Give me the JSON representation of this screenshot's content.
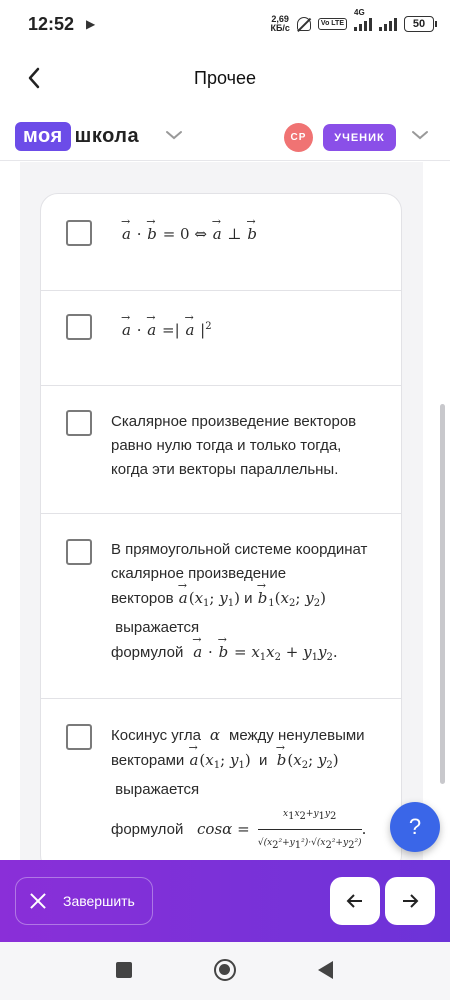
{
  "status_bar": {
    "time": "12:52",
    "speed_value": "2,69",
    "speed_unit": "КБ/с",
    "volte": "Vo LTE",
    "network": "4G",
    "battery": "50"
  },
  "header": {
    "title": "Прочее",
    "back_icon": "chevron-left-icon"
  },
  "brand": {
    "logo_part1": "моя",
    "logo_part2": "школа",
    "avatar_initials": "СР",
    "role": "УЧЕНИК",
    "colors": {
      "logo": "#6c4ce8",
      "role_badge": "#8a4fe8",
      "avatar": "#f07373"
    }
  },
  "options": [
    {
      "id": 1,
      "checked": false,
      "formula": "a · b = 0 ⇔ a ⊥ b"
    },
    {
      "id": 2,
      "checked": false,
      "formula": "a · a = | a |²"
    },
    {
      "id": 3,
      "checked": false,
      "text": "Скалярное произведение векторов равно нулю тогда и только тогда, когда эти векторы параллельны."
    },
    {
      "id": 4,
      "checked": false,
      "line1": "В прямоугольной системе координат",
      "line2": "скалярное произведение",
      "line3_prefix": "векторов",
      "line3_mid": "и",
      "line4": "выражается",
      "line5_prefix": "формулой"
    },
    {
      "id": 5,
      "checked": false,
      "line1_prefix": "Косинус угла",
      "line1_suffix": "между ненулевыми",
      "line2_prefix": "векторами",
      "line2_mid": "и",
      "line3": "выражается",
      "line4_prefix": "формулой"
    }
  ],
  "help_button": {
    "label": "?"
  },
  "action_bar": {
    "finish_label": "Завершить",
    "prev_icon": "arrow-left-icon",
    "next_icon": "arrow-right-icon",
    "gradient": [
      "#8a2fd8",
      "#6c33d8"
    ]
  }
}
